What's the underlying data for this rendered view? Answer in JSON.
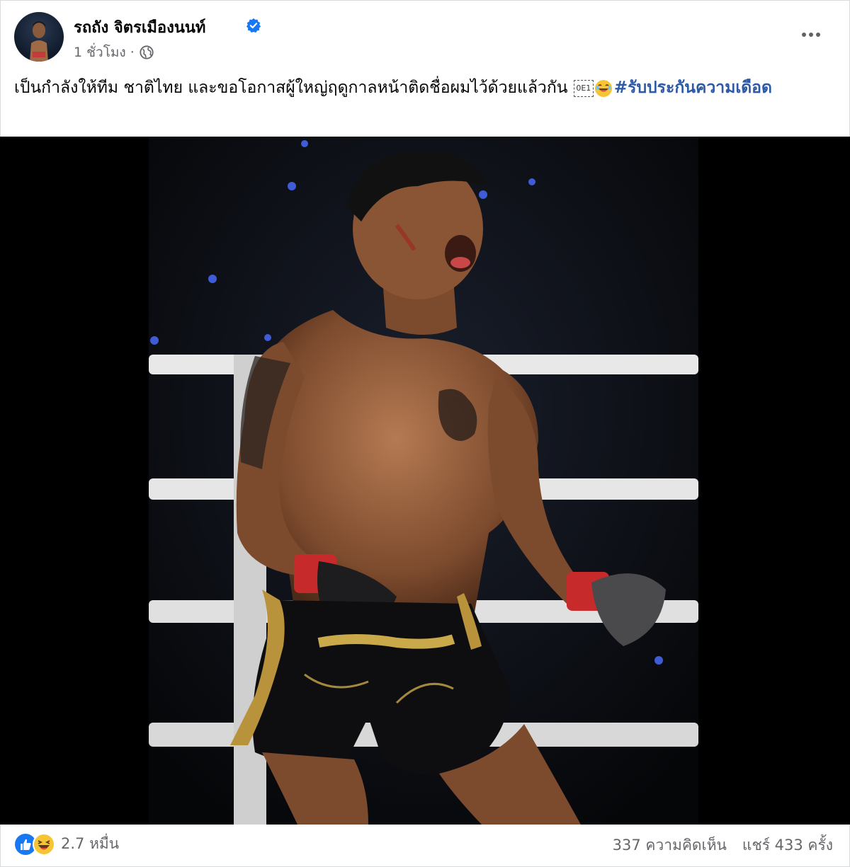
{
  "post": {
    "author_name": "รถถัง จิตรเมืองนนท์",
    "timestamp": "1 ชั่วโมง",
    "meta_separator": "·",
    "privacy_icon": "globe-icon",
    "verified_icon": "verified-badge-icon",
    "more_icon": "more-options-icon",
    "caption_text": "เป็นกำลังให้ทีม ชาติไทย  และขอโอกาสผู้ใหญ่ฤดูกาลหน้าติดชื่อผมไว้ด้วยแล้วกัน ",
    "caption_emoji_box": "0E1",
    "hashtag": "#รับประกันความเดือด"
  },
  "footer": {
    "reaction_icons": [
      "like-icon",
      "haha-icon"
    ],
    "reaction_count": "2.7 หมื่น",
    "comments": "337 ความคิดเห็น",
    "shares": "แชร์ 433 ครั้ง"
  },
  "colors": {
    "link": "#2d59a5",
    "verified": "#1877f2",
    "meta_text": "#65676b"
  }
}
